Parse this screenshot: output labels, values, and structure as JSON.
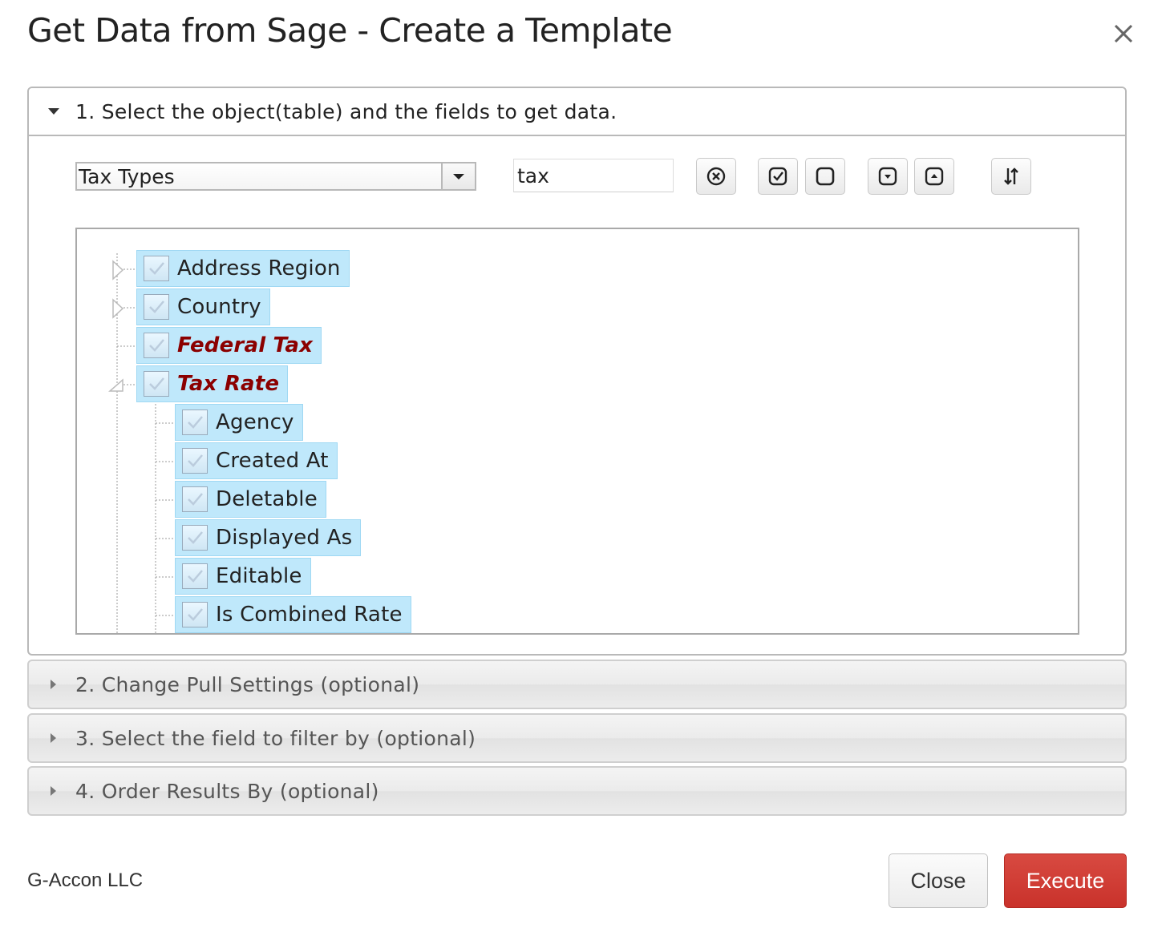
{
  "dialog": {
    "title": "Get Data from Sage - Create a Template"
  },
  "section1": {
    "label": "1. Select the object(table) and the fields to get data.",
    "object_select": {
      "value": "Tax Types"
    },
    "search": {
      "value": "tax"
    },
    "toolbar_icons": [
      "clear-search-icon",
      "check-all-icon",
      "uncheck-all-icon",
      "expand-all-icon",
      "collapse-all-icon",
      "sort-icon"
    ],
    "tree": {
      "nodes": [
        {
          "label": "Address Region",
          "checked": true,
          "emphasis": false,
          "expandable": true
        },
        {
          "label": "Country",
          "checked": true,
          "emphasis": false,
          "expandable": true
        },
        {
          "label": "Federal Tax",
          "checked": true,
          "emphasis": true,
          "expandable": false
        },
        {
          "label": "Tax Rate",
          "checked": true,
          "emphasis": true,
          "expanded": true
        },
        {
          "label": "Agency",
          "checked": true,
          "emphasis": false
        },
        {
          "label": "Created At",
          "checked": true,
          "emphasis": false
        },
        {
          "label": "Deletable",
          "checked": true,
          "emphasis": false
        },
        {
          "label": "Displayed As",
          "checked": true,
          "emphasis": false
        },
        {
          "label": "Editable",
          "checked": true,
          "emphasis": false
        },
        {
          "label": "Is Combined Rate",
          "checked": true,
          "emphasis": false
        }
      ]
    }
  },
  "section2": {
    "label": "2. Change Pull Settings (optional)"
  },
  "section3": {
    "label": "3. Select the field to filter by (optional)"
  },
  "section4": {
    "label": "4. Order Results By (optional)"
  },
  "footer": {
    "brand": "G-Accon LLC",
    "close_label": "Close",
    "execute_label": "Execute"
  },
  "colors": {
    "execute": "#c9322b",
    "selected_node": "#bfe8fb",
    "emphasis_text": "#8b0000"
  }
}
